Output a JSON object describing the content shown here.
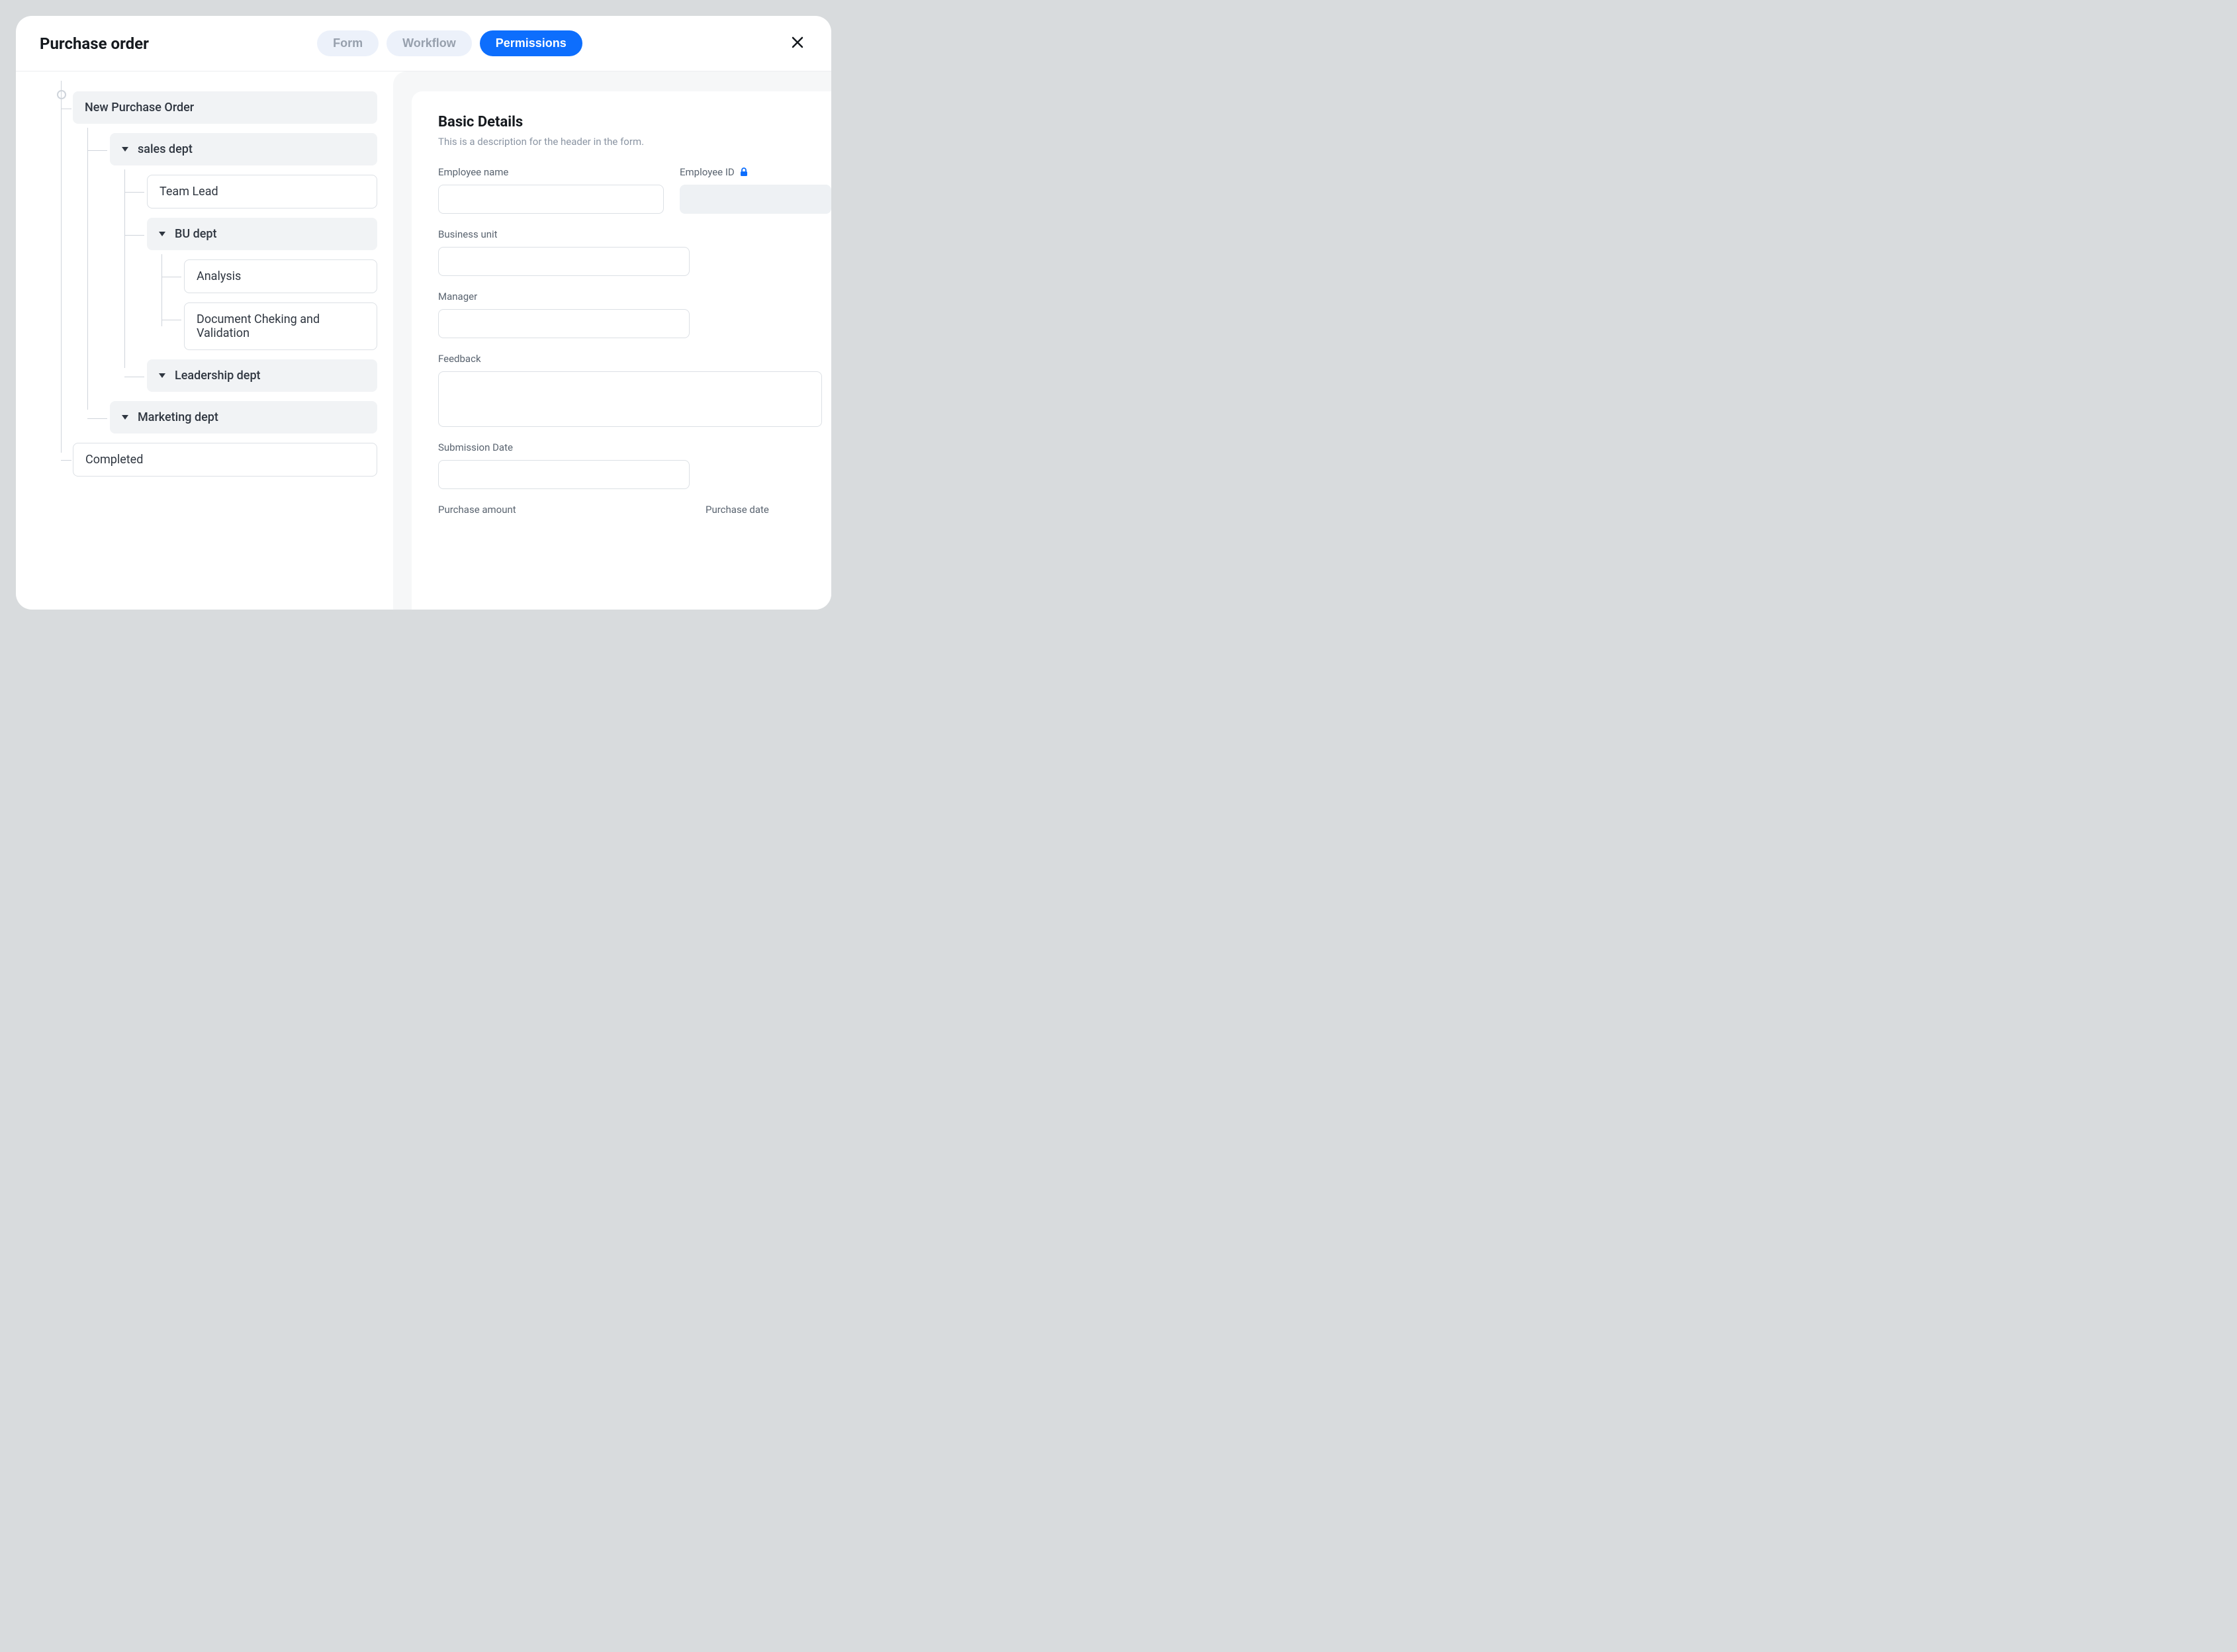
{
  "header": {
    "title": "Purchase order",
    "tabs": [
      {
        "label": "Form",
        "active": false
      },
      {
        "label": "Workflow",
        "active": false
      },
      {
        "label": "Permissions",
        "active": true
      }
    ]
  },
  "tree": {
    "root": "New Purchase Order",
    "sales_dept": "sales dept",
    "team_lead": "Team Lead",
    "bu_dept": "BU dept",
    "analysis": "Analysis",
    "doc_check": "Document Cheking and Validation",
    "leadership_dept": "Leadership dept",
    "marketing_dept": "Marketing dept",
    "completed": "Completed"
  },
  "form": {
    "section_title": "Basic Details",
    "section_desc": "This is a description for the header in the form.",
    "labels": {
      "employee_name": "Employee name",
      "employee_id": "Employee ID",
      "business_unit": "Business unit",
      "manager": "Manager",
      "feedback": "Feedback",
      "submission_date": "Submission Date",
      "purchase_amount": "Purchase amount",
      "purchase_date": "Purchase date"
    }
  }
}
